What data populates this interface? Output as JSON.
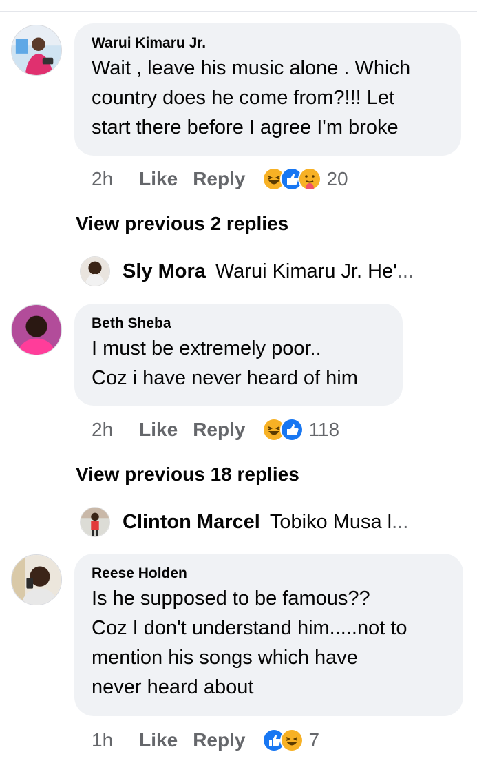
{
  "comments": [
    {
      "author": "Warui Kimaru Jr.",
      "lines": [
        "Wait , leave his music alone . Which",
        "country does he come from?!!! Let",
        "start there before I agree I'm broke"
      ],
      "time": "2h",
      "like": "Like",
      "reply": "Reply",
      "reactions": [
        "haha-icon",
        "like-icon",
        "care-icon"
      ],
      "reaction_count": "20",
      "view_previous": "View previous 2 replies",
      "preview": {
        "author": "Sly Mora",
        "text": "Warui Kimaru Jr. He'",
        "ellipsis": "..."
      }
    },
    {
      "author": "Beth Sheba",
      "lines": [
        "I must be extremely poor..",
        "Coz i have never heard of him"
      ],
      "time": "2h",
      "like": "Like",
      "reply": "Reply",
      "reactions": [
        "haha-icon",
        "like-icon"
      ],
      "reaction_count": "118",
      "view_previous": "View previous 18 replies",
      "preview": {
        "author": "Clinton Marcel",
        "text": "Tobiko Musa l",
        "ellipsis": "..."
      }
    },
    {
      "author": "Reese Holden",
      "lines": [
        "Is he supposed to be famous??",
        "Coz I don't understand him.....not to",
        "mention his songs which have",
        "never heard about"
      ],
      "time": "1h",
      "like": "Like",
      "reply": "Reply",
      "reactions": [
        "like-icon",
        "haha-icon"
      ],
      "reaction_count": "7"
    }
  ],
  "colors": {
    "bubble": "#f0f2f5",
    "meta": "#65676b",
    "like_blue": "#1877f2",
    "haha_yellow": "#f7b125"
  }
}
